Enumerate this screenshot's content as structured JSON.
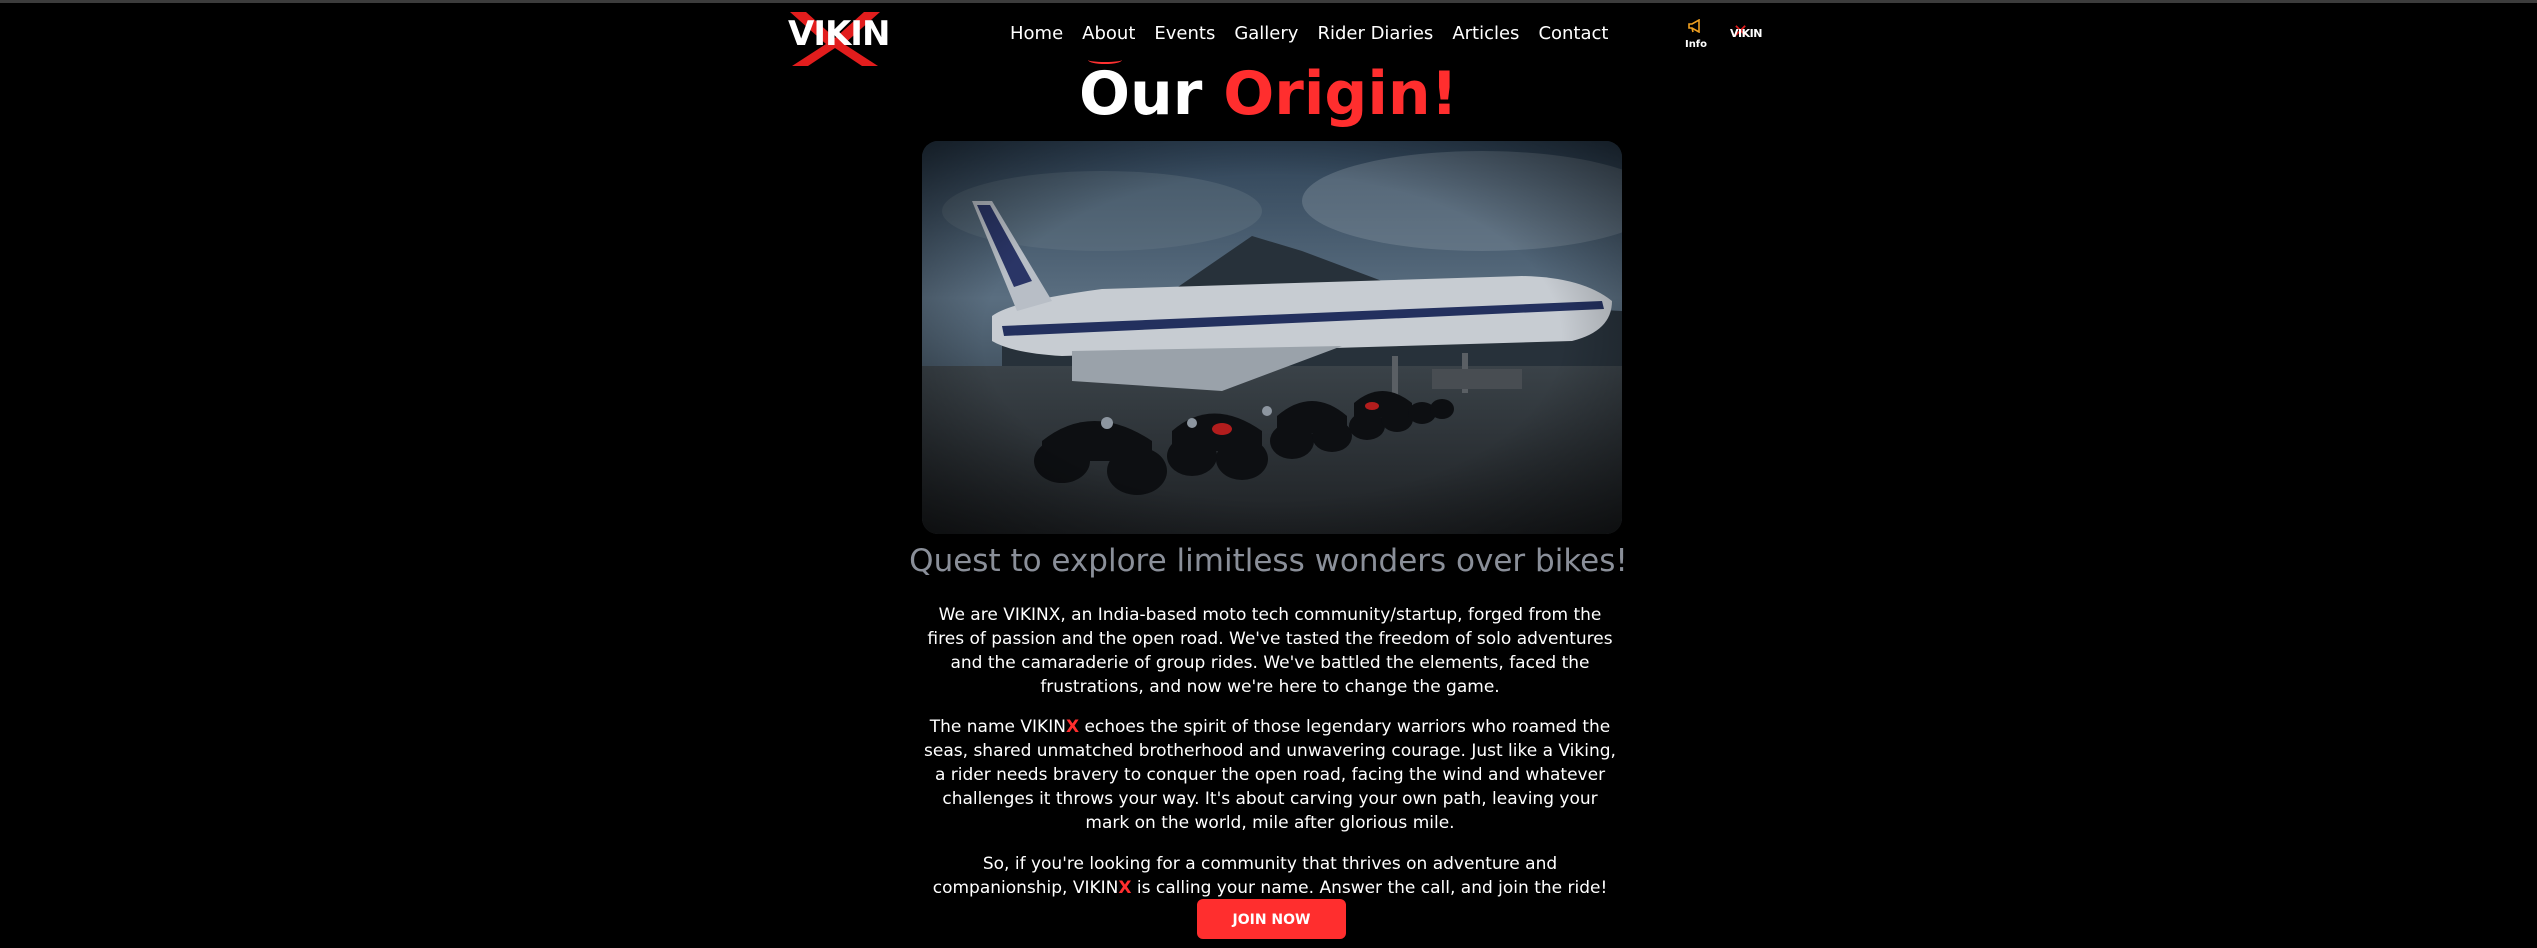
{
  "header": {
    "logo_text": "VIKIN",
    "nav": [
      {
        "label": "Home"
      },
      {
        "label": "About"
      },
      {
        "label": "Events"
      },
      {
        "label": "Gallery"
      },
      {
        "label": "Rider Diaries"
      },
      {
        "label": "Articles"
      },
      {
        "label": "Contact"
      }
    ],
    "active_nav": "About",
    "info_label": "Info",
    "mini_logo_text": "VIKIN"
  },
  "hero": {
    "title_part1": "Our",
    "title_part2": "Origin!",
    "image_alt_icon": "photo-airplane-motorcycles"
  },
  "content": {
    "subtitle": "Quest to explore limitless wonders over bikes!",
    "p1": "We are VIKINX, an India-based moto tech community/startup, forged from the fires of passion and the open road. We've tasted the freedom of solo adventures and the camaraderie of group rides. We've battled the elements, faced the frustrations, and now we're here to change the game.",
    "p2_pre": "The name VIKIN",
    "p2_x": "X",
    "p2_post": " echoes the spirit of those legendary warriors who roamed the seas, shared unmatched brotherhood and unwavering courage. Just like a Viking, a rider needs bravery to conquer the open road, facing the wind and whatever challenges it throws your way. It's about carving your own path, leaving your mark on the world, mile after glorious mile.",
    "p3_pre": "So, if you're looking for a community that thrives on adventure and companionship, VIKIN",
    "p3_x": "X",
    "p3_post": " is calling your name. Answer the call, and join the ride!",
    "join_label": "JOIN NOW"
  },
  "colors": {
    "accent": "#ff2e2e",
    "background": "#000000",
    "subtitle": "#8a8f99"
  }
}
